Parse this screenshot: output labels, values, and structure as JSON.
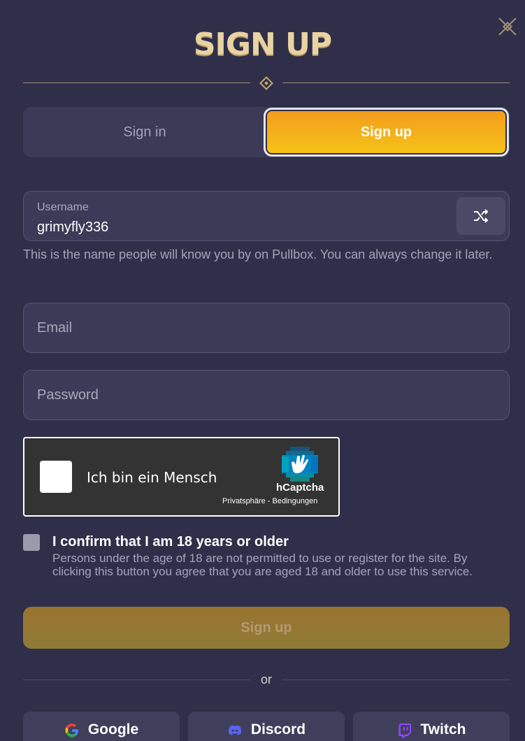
{
  "modal": {
    "title": "SIGN UP"
  },
  "tabs": {
    "signin_label": "Sign in",
    "signup_label": "Sign up",
    "active": "signup"
  },
  "username": {
    "label": "Username",
    "value": "grimyfly336",
    "helper": "This is the name people will know you by on Pullbox. You can always change it later."
  },
  "email": {
    "placeholder": "Email",
    "value": ""
  },
  "password": {
    "placeholder": "Password",
    "value": ""
  },
  "captcha": {
    "label": "Ich bin ein Mensch",
    "brand": "hCaptcha",
    "links": "Privatsphäre - Bedingungen"
  },
  "age_confirm": {
    "title": "I confirm that I am 18 years or older",
    "description": "Persons under the age of 18 are not permitted to use or register for the site. By clicking this button you agree that you are aged 18 and older to use this service.",
    "checked": false
  },
  "submit": {
    "label": "Sign up"
  },
  "divider": {
    "text": "or"
  },
  "social": {
    "google": "Google",
    "discord": "Discord",
    "twitch": "Twitch"
  },
  "colors": {
    "background": "#2f2f4a",
    "field_bg": "#3b3b58",
    "accent_start": "#f39b1c",
    "accent_end": "#f5c418",
    "title": "#e9d3a2",
    "muted_text": "#a3a3b8"
  },
  "icons": {
    "close": "close-icon",
    "shuffle": "shuffle-icon",
    "diamond": "diamond-ornament-icon",
    "captcha": "hcaptcha-logo-icon",
    "google": "google-icon",
    "discord": "discord-icon",
    "twitch": "twitch-icon"
  }
}
